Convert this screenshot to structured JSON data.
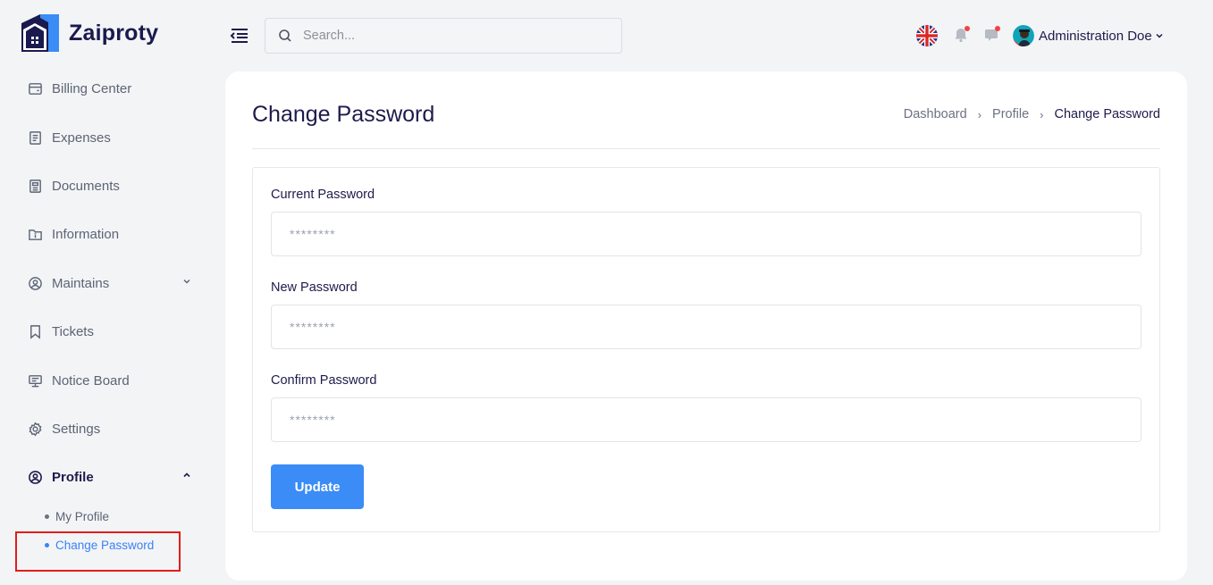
{
  "brand": {
    "name": "Zaiproty"
  },
  "sidebar": {
    "items": [
      {
        "label": "Billing Center",
        "icon": "billing-icon"
      },
      {
        "label": "Expenses",
        "icon": "receipt-icon"
      },
      {
        "label": "Documents",
        "icon": "document-icon"
      },
      {
        "label": "Information",
        "icon": "info-folder-icon"
      },
      {
        "label": "Maintains",
        "icon": "user-circle-icon"
      },
      {
        "label": "Tickets",
        "icon": "bookmark-icon"
      },
      {
        "label": "Notice Board",
        "icon": "board-icon"
      },
      {
        "label": "Settings",
        "icon": "gear-icon"
      },
      {
        "label": "Profile",
        "icon": "user-circle-icon"
      }
    ],
    "profile_sub": [
      {
        "label": "My Profile"
      },
      {
        "label": "Change Password"
      }
    ]
  },
  "topbar": {
    "search_placeholder": "Search...",
    "user_name": "Administration Doe"
  },
  "page": {
    "title": "Change Password",
    "breadcrumb": [
      "Dashboard",
      "Profile",
      "Change Password"
    ]
  },
  "form": {
    "fields": [
      {
        "label": "Current Password",
        "placeholder": "********"
      },
      {
        "label": "New Password",
        "placeholder": "********"
      },
      {
        "label": "Confirm Password",
        "placeholder": "********"
      }
    ],
    "submit_label": "Update"
  },
  "colors": {
    "accent": "#3b8cf6",
    "brand_dark": "#1a1a4e",
    "highlight": "#e11d1d",
    "badge": "#ef4444"
  }
}
